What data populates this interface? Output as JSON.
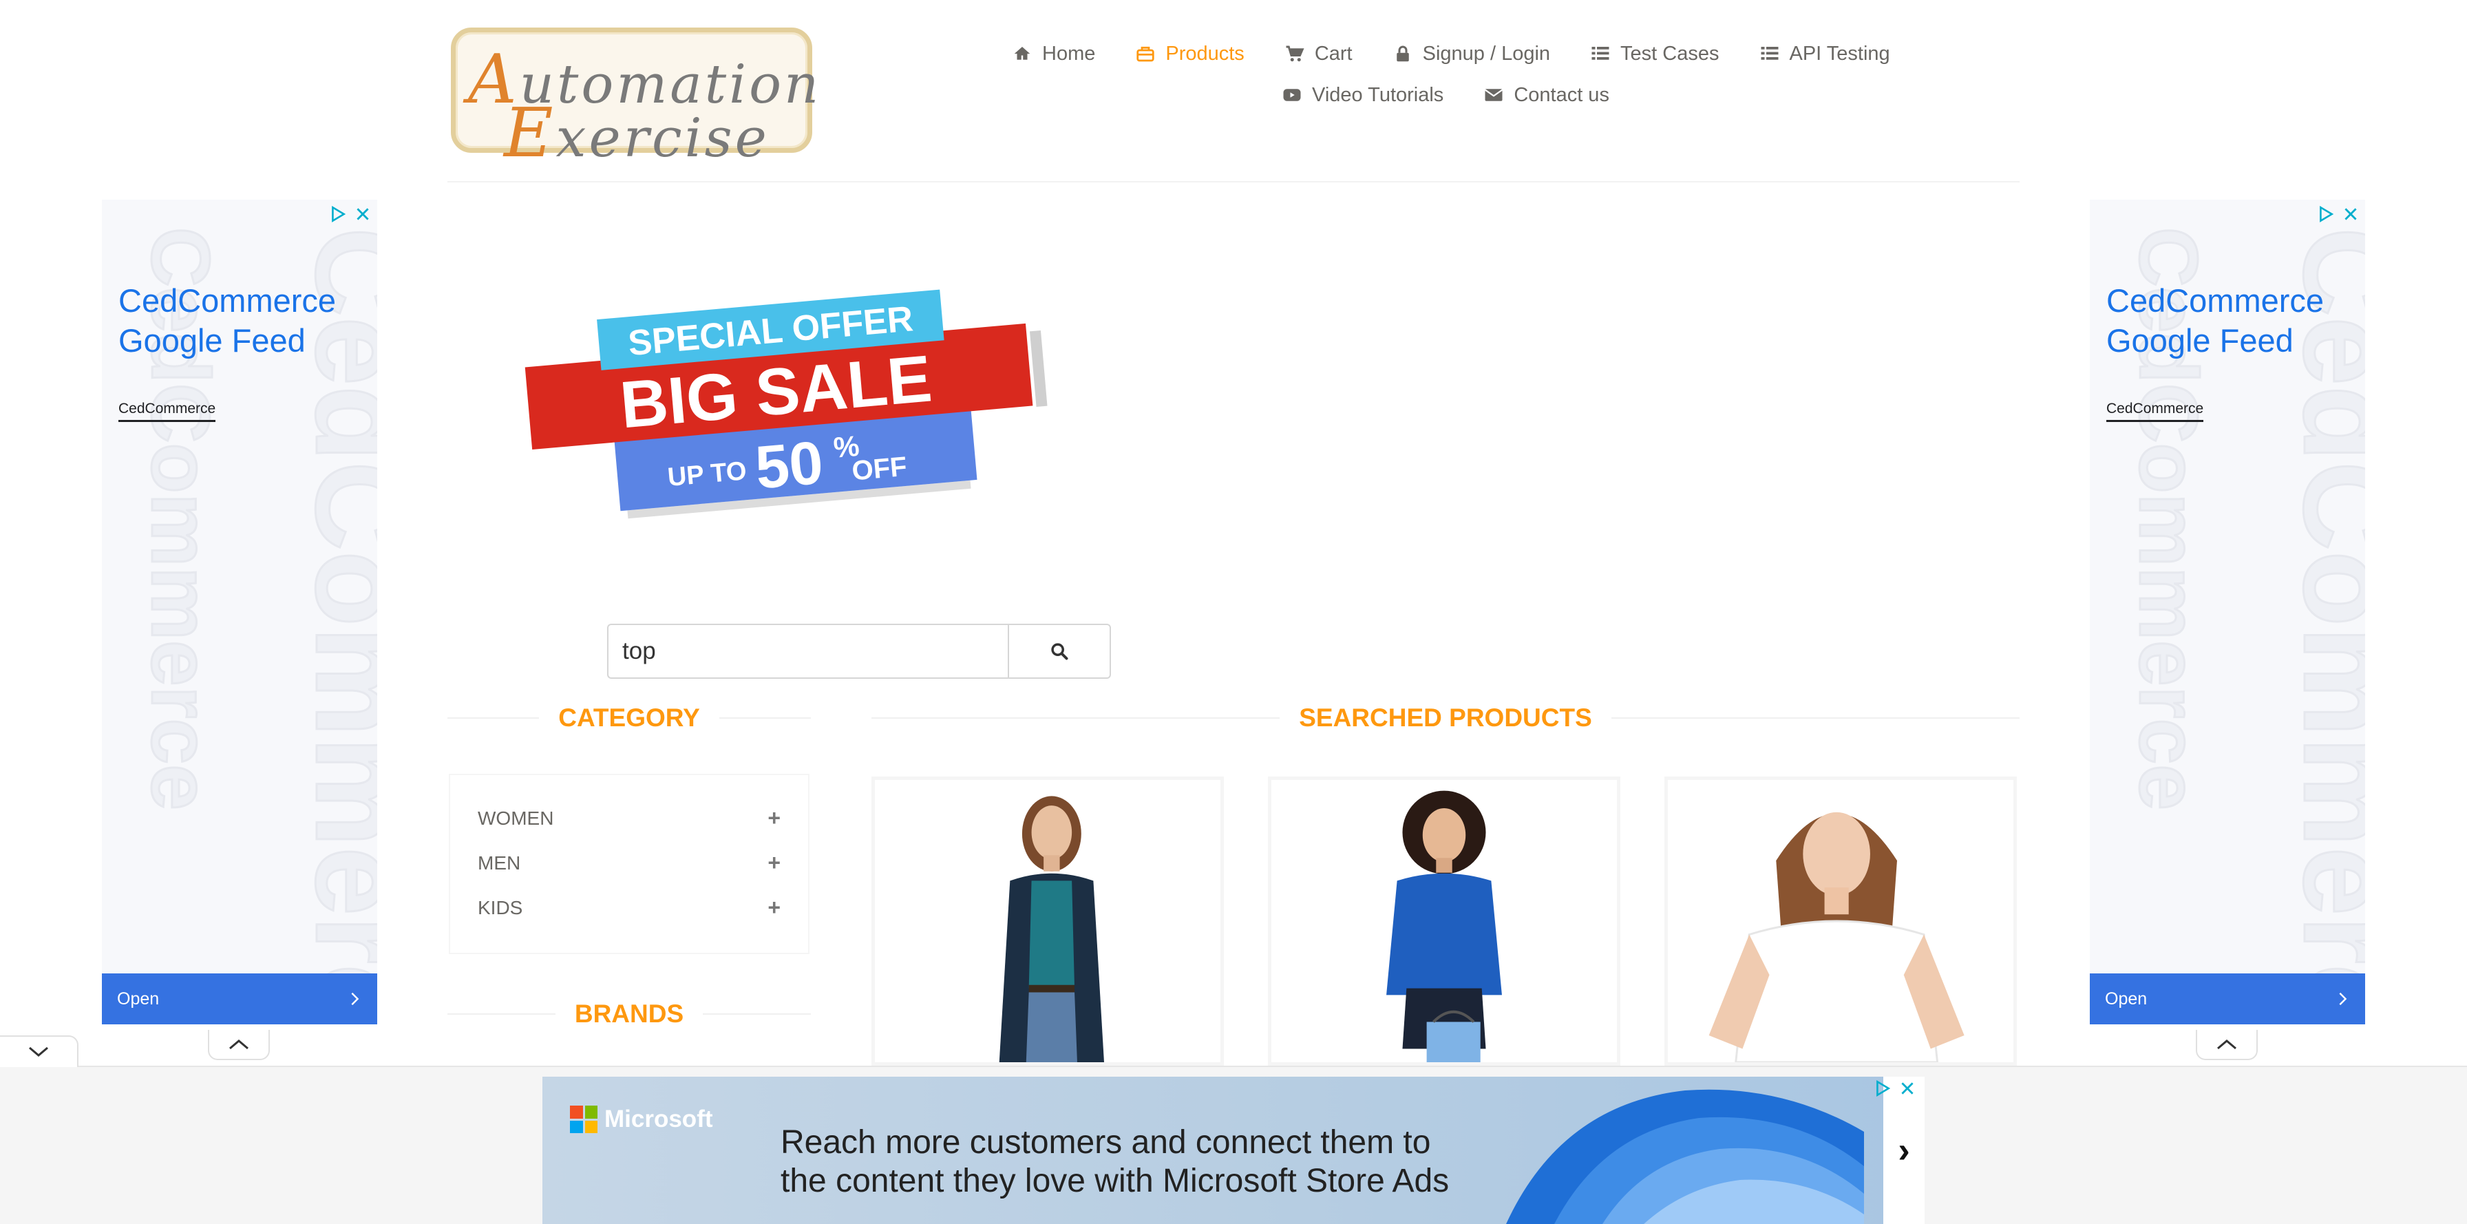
{
  "header": {
    "logo": {
      "line1_cap": "A",
      "line1_rest": "utomation",
      "line2_cap": "E",
      "line2_rest": "xercise"
    },
    "nav_row1": [
      {
        "label": "Home",
        "icon": "home-icon"
      },
      {
        "label": "Products",
        "icon": "products-icon",
        "active": true
      },
      {
        "label": "Cart",
        "icon": "cart-icon"
      },
      {
        "label": "Signup / Login",
        "icon": "lock-icon"
      },
      {
        "label": "Test Cases",
        "icon": "list-icon"
      },
      {
        "label": "API Testing",
        "icon": "list-icon"
      }
    ],
    "nav_row2": [
      {
        "label": "Video Tutorials",
        "icon": "youtube-icon"
      },
      {
        "label": "Contact us",
        "icon": "envelope-icon"
      }
    ]
  },
  "side_ad": {
    "headline": "CedCommerce Google Feed",
    "advertiser": "CedCommerce",
    "watermark": "CedCommerce",
    "open_label": "Open"
  },
  "banner": {
    "top": "SPECIAL OFFER",
    "middle": "BIG SALE",
    "bottom_small": "UP TO",
    "bottom_big": "50",
    "bottom_pct": "%",
    "bottom_off": "OFF"
  },
  "search": {
    "value": "top"
  },
  "sections": {
    "category": "CATEGORY",
    "brands": "BRANDS",
    "searched": "SEARCHED PRODUCTS"
  },
  "categories": [
    {
      "label": "WOMEN"
    },
    {
      "label": "MEN"
    },
    {
      "label": "KIDS"
    }
  ],
  "bottom_ad": {
    "brand": "Microsoft",
    "copy": "Reach more customers and connect them to the content they love with Microsoft Store Ads",
    "arrow": "›"
  },
  "colors": {
    "accent": "#fe980f",
    "ad_blue": "#1a73e8",
    "open_button": "#3572e1"
  }
}
